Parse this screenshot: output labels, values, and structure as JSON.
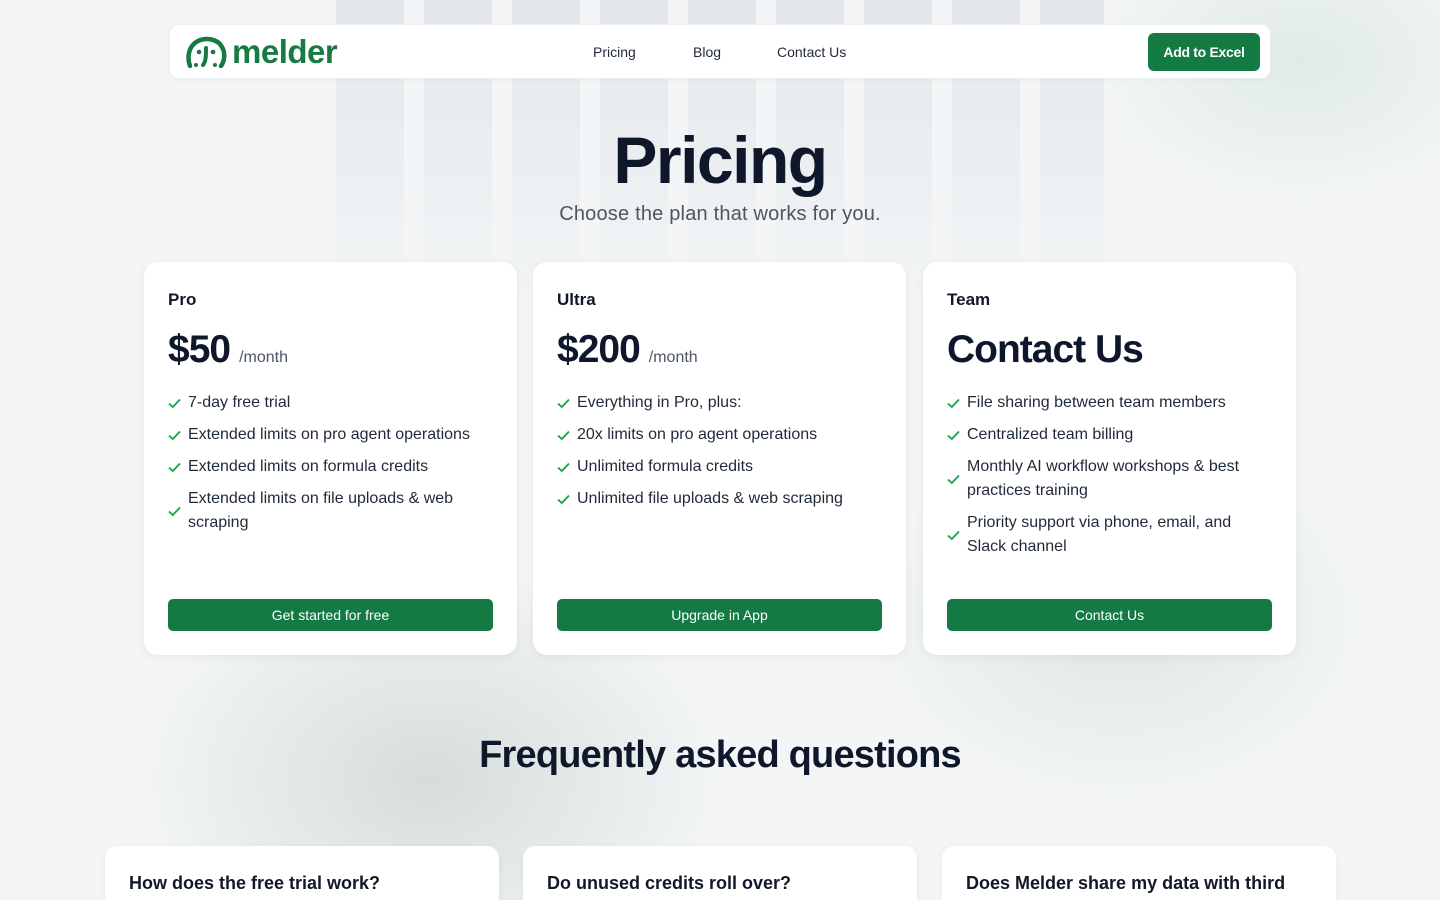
{
  "brand": {
    "name": "melder",
    "logo_icon": "elephant-icon",
    "accent": "#127a42"
  },
  "nav": {
    "links": [
      "Pricing",
      "Blog",
      "Contact Us"
    ],
    "cta": "Add to Excel"
  },
  "hero": {
    "title": "Pricing",
    "subtitle": "Choose the plan that works for you."
  },
  "plans": [
    {
      "name": "Pro",
      "price": "$50",
      "period": "/month",
      "features": [
        "7-day free trial",
        "Extended limits on pro agent operations",
        "Extended limits on formula credits",
        "Extended limits on file uploads & web scraping"
      ],
      "button": "Get started for free"
    },
    {
      "name": "Ultra",
      "price": "$200",
      "period": "/month",
      "features": [
        "Everything in Pro, plus:",
        "20x limits on pro agent operations",
        "Unlimited formula credits",
        "Unlimited file uploads & web scraping"
      ],
      "button": "Upgrade in App"
    },
    {
      "name": "Team",
      "price": "Contact Us",
      "period": "",
      "features": [
        "File sharing between team members",
        "Centralized team billing",
        "Monthly AI workflow workshops & best practices training",
        "Priority support via phone, email, and Slack channel"
      ],
      "button": "Contact Us"
    }
  ],
  "faq": {
    "title": "Frequently asked questions",
    "questions": [
      "How does the free trial work?",
      "Do unused credits roll over?",
      "Does Melder share my data with third"
    ]
  }
}
